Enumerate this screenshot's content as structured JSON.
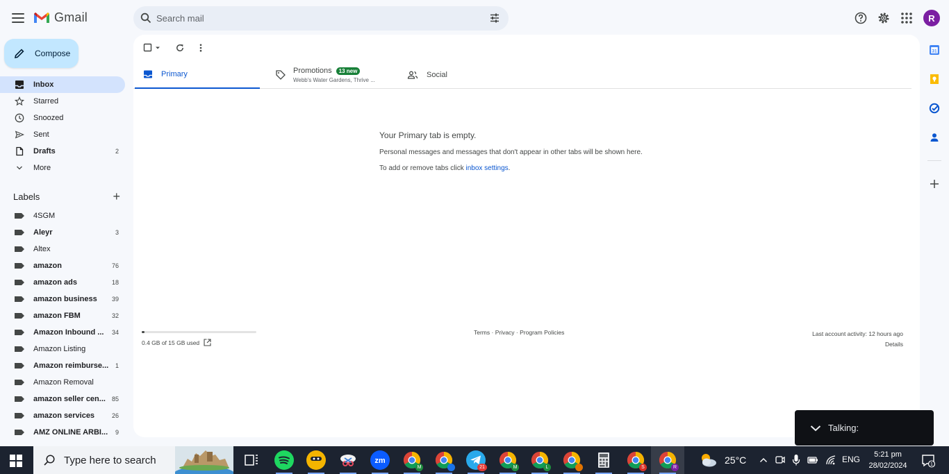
{
  "app": {
    "name": "Gmail"
  },
  "search": {
    "placeholder": "Search mail"
  },
  "compose": {
    "label": "Compose"
  },
  "nav": [
    {
      "label": "Inbox",
      "count": "",
      "active": true,
      "icon": "inbox-icon"
    },
    {
      "label": "Starred",
      "count": "",
      "icon": "star-icon"
    },
    {
      "label": "Snoozed",
      "count": "",
      "icon": "clock-icon"
    },
    {
      "label": "Sent",
      "count": "",
      "icon": "send-icon"
    },
    {
      "label": "Drafts",
      "count": "2",
      "bold": true,
      "icon": "draft-icon"
    },
    {
      "label": "More",
      "count": "",
      "icon": "chevron-down-icon"
    }
  ],
  "labels": {
    "title": "Labels",
    "items": [
      {
        "label": "4SGM",
        "count": ""
      },
      {
        "label": "Aleyr",
        "count": "3",
        "bold": true
      },
      {
        "label": "Altex",
        "count": ""
      },
      {
        "label": "amazon",
        "count": "76",
        "bold": true
      },
      {
        "label": "amazon ads",
        "count": "18",
        "bold": true
      },
      {
        "label": "amazon business",
        "count": "39",
        "bold": true
      },
      {
        "label": "amazon FBM",
        "count": "32",
        "bold": true
      },
      {
        "label": "Amazon Inbound ...",
        "count": "34",
        "bold": true
      },
      {
        "label": "Amazon Listing",
        "count": ""
      },
      {
        "label": "Amazon reimburse...",
        "count": "1",
        "bold": true
      },
      {
        "label": "Amazon Removal",
        "count": ""
      },
      {
        "label": "amazon seller cen...",
        "count": "85",
        "bold": true
      },
      {
        "label": "amazon services",
        "count": "26",
        "bold": true
      },
      {
        "label": "AMZ ONLINE ARBI...",
        "count": "9",
        "bold": true
      }
    ]
  },
  "tabs": {
    "primary": "Primary",
    "promotions": "Promotions",
    "promotions_badge": "13 new",
    "promotions_sub": "Webb's Water Gardens, Thrive ...",
    "social": "Social"
  },
  "empty": {
    "title": "Your Primary tab is empty.",
    "line1": "Personal messages and messages that don't appear in other tabs will be shown here.",
    "line2_prefix": "To add or remove tabs click ",
    "line2_link": "inbox settings",
    "line2_suffix": "."
  },
  "footer": {
    "storage": "0.4 GB of 15 GB used",
    "storage_fraction": 0.027,
    "links": "Terms · Privacy · Program Policies",
    "activity": "Last account activity: 12 hours ago",
    "details": "Details"
  },
  "avatar": {
    "initial": "R",
    "color": "#7b1fa2"
  },
  "toast": {
    "text": "Talking:"
  },
  "taskbar": {
    "search_placeholder": "Type here to search",
    "temperature": "25°C",
    "language": "ENG",
    "time": "5:21 pm",
    "date": "28/02/2024",
    "telegram_badge": "21",
    "notification_count": "1"
  }
}
